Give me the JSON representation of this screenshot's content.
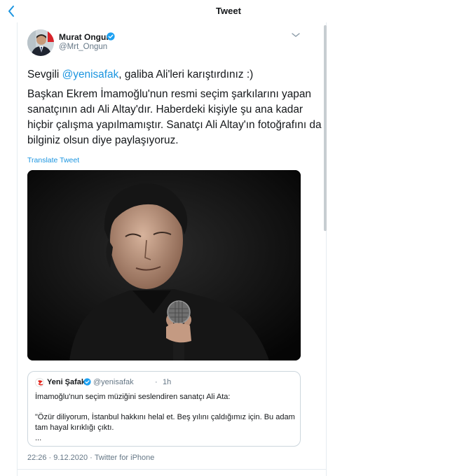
{
  "header": {
    "title": "Tweet"
  },
  "author": {
    "name": "Murat Ongun",
    "handle": "@Mrt_Ongun"
  },
  "tweet": {
    "lines": [
      {
        "prefix": "Sevgili ",
        "mention": "@yenisafak",
        "suffix": ", galiba Ali'leri karıştırdınız :)"
      },
      "Başkan Ekrem İmamoğlu'nun resmi seçim şarkılarını yapan",
      "sanatçının adı Ali Altay'dır. Haberdeki kişiyle şu ana kadar",
      "hiçbir çalışma yapılmamıştır. Sanatçı Ali Altay'ın fotoğrafını da",
      "bilginiz olsun diye paylaşıyoruz."
    ],
    "translate_label": "Translate Tweet"
  },
  "quote": {
    "name": "Yeni Şafak",
    "handle": "@yenisafak",
    "separator": "·",
    "time": "1h",
    "lines": [
      "İmamoğlu'nun seçim müziğini seslendiren sanatçı Ali Ata:",
      "\"Özür diliyorum, İstanbul hakkını helal et. Beş yılını çaldığımız için. Bu adam",
      "tam hayal kırıklığı çıktı.",
      "..."
    ]
  },
  "meta": {
    "time": "22:26",
    "separator": "·",
    "date": "9.12.2020",
    "source": "Twitter for iPhone"
  },
  "colors": {
    "accent": "#1b95e0",
    "text": "#14171a",
    "secondary": "#657786",
    "border": "#ccd6dd"
  }
}
